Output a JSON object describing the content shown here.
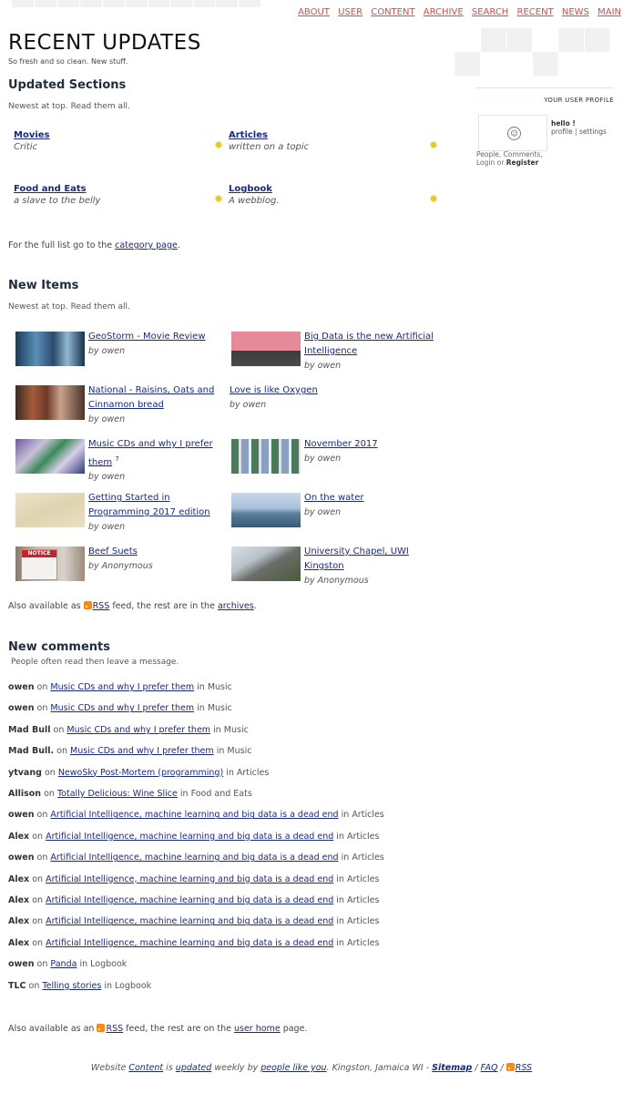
{
  "nav": [
    "ABOUT",
    "USER",
    "CONTENT",
    "ARCHIVE",
    "SEARCH",
    "RECENT",
    "NEWS",
    "MAIN"
  ],
  "page": {
    "title": "RECENT UPDATES",
    "tagline": "So fresh and so clean. New stuff."
  },
  "updated_sections": {
    "heading": "Updated Sections",
    "sub": "Newest at top. Read them all.",
    "items": [
      {
        "name": "Movies",
        "desc": "Critic"
      },
      {
        "name": "Articles",
        "desc": "written on a topic"
      },
      {
        "name": "Food and Eats",
        "desc": "a slave to the belly"
      },
      {
        "name": "Logbook",
        "desc": "A webblog."
      }
    ],
    "full_list_pre": "For the full list go to the ",
    "full_list_link": "category page",
    "full_list_post": "."
  },
  "new_items": {
    "heading": "New Items",
    "sub": "Newest at top. Read them all.",
    "items": [
      {
        "title": "GeoStorm - Movie Review",
        "by": "by owen"
      },
      {
        "title": "Big Data is the new Artificial Intelligence",
        "by": "by owen"
      },
      {
        "title": "National - Raisins, Oats and Cinnamon bread",
        "by": "by owen"
      },
      {
        "title": "Love is like Oxygen",
        "by": "by owen"
      },
      {
        "title": "Music CDs and why I prefer them",
        "sup": "7",
        "by": "by owen"
      },
      {
        "title": "November 2017",
        "by": "by owen"
      },
      {
        "title": "Getting Started in Programming 2017 edition",
        "by": "by owen"
      },
      {
        "title": "On the water",
        "by": "by owen"
      },
      {
        "title": "Beef Suets",
        "by": "by Anonymous"
      },
      {
        "title": "University Chapel, UWI Kingston",
        "by": "by Anonymous"
      }
    ],
    "thumbs": [
      "NOTICE"
    ],
    "also_pre": "Also available as ",
    "rss": "RSS",
    "also_mid": " feed, the rest are in the ",
    "archives": "archives",
    "also_post": "."
  },
  "comments": {
    "heading": "New comments",
    "sub": "People often read then leave a message.",
    "on": "on",
    "in": "in",
    "items": [
      {
        "user": "owen",
        "title": "Music CDs and why I prefer them",
        "cat": "Music"
      },
      {
        "user": "owen",
        "title": "Music CDs and why I prefer them",
        "cat": "Music"
      },
      {
        "user": "Mad Bull",
        "title": "Music CDs and why I prefer them",
        "cat": "Music"
      },
      {
        "user": "Mad Bull.",
        "title": "Music CDs and why I prefer them",
        "cat": "Music"
      },
      {
        "user": "ytvang",
        "title": "NewoSky Post-Mortem (programming)",
        "cat": "Articles"
      },
      {
        "user": "Allison",
        "title": "Totally Delicious: Wine Slice",
        "cat": "Food and Eats"
      },
      {
        "user": "owen",
        "title": "Artificial Intelligence, machine learning and big data is a dead end",
        "cat": "Articles"
      },
      {
        "user": "Alex",
        "title": "Artificial Intelligence, machine learning and big data is a dead end",
        "cat": "Articles"
      },
      {
        "user": "owen",
        "title": "Artificial Intelligence, machine learning and big data is a dead end",
        "cat": "Articles"
      },
      {
        "user": "Alex",
        "title": "Artificial Intelligence, machine learning and big data is a dead end",
        "cat": "Articles"
      },
      {
        "user": "Alex",
        "title": "Artificial Intelligence, machine learning and big data is a dead end",
        "cat": "Articles"
      },
      {
        "user": "Alex",
        "title": "Artificial Intelligence, machine learning and big data is a dead end",
        "cat": "Articles"
      },
      {
        "user": "Alex",
        "title": "Artificial Intelligence, machine learning and big data is a dead end",
        "cat": "Articles"
      },
      {
        "user": "owen",
        "title": "Panda",
        "cat": "Logbook"
      },
      {
        "user": "TLC",
        "title": "Telling stories",
        "cat": "Logbook"
      }
    ],
    "also_pre": "Also available as an ",
    "rss": "RSS",
    "also_mid": " feed, the rest are on the ",
    "user_home": "user home",
    "also_post": " page."
  },
  "profile": {
    "heading": "YOUR USER PROFILE",
    "hello": "hello !",
    "profile_link": "profile",
    "sep": "|",
    "settings_link": "settings",
    "people_line": "People, Comments,",
    "login": "Login",
    "or": "or",
    "register": "Register"
  },
  "footer": {
    "website": "Website ",
    "content": "Content",
    "is": " is ",
    "updated": "updated",
    "weekly": " weekly by ",
    "people": "people like you",
    "kingston": ". Kingston, Jamaica WI - ",
    "sitemap": "Sitemap",
    "slash1": " / ",
    "faq": "FAQ",
    "slash2": " / ",
    "rss": "RSS"
  },
  "colors": {
    "nav": "#d84a4a",
    "link": "#1a2a7a",
    "heading": "#1f2d3d",
    "star": "#e7c632",
    "rss": "#f58a1f"
  }
}
